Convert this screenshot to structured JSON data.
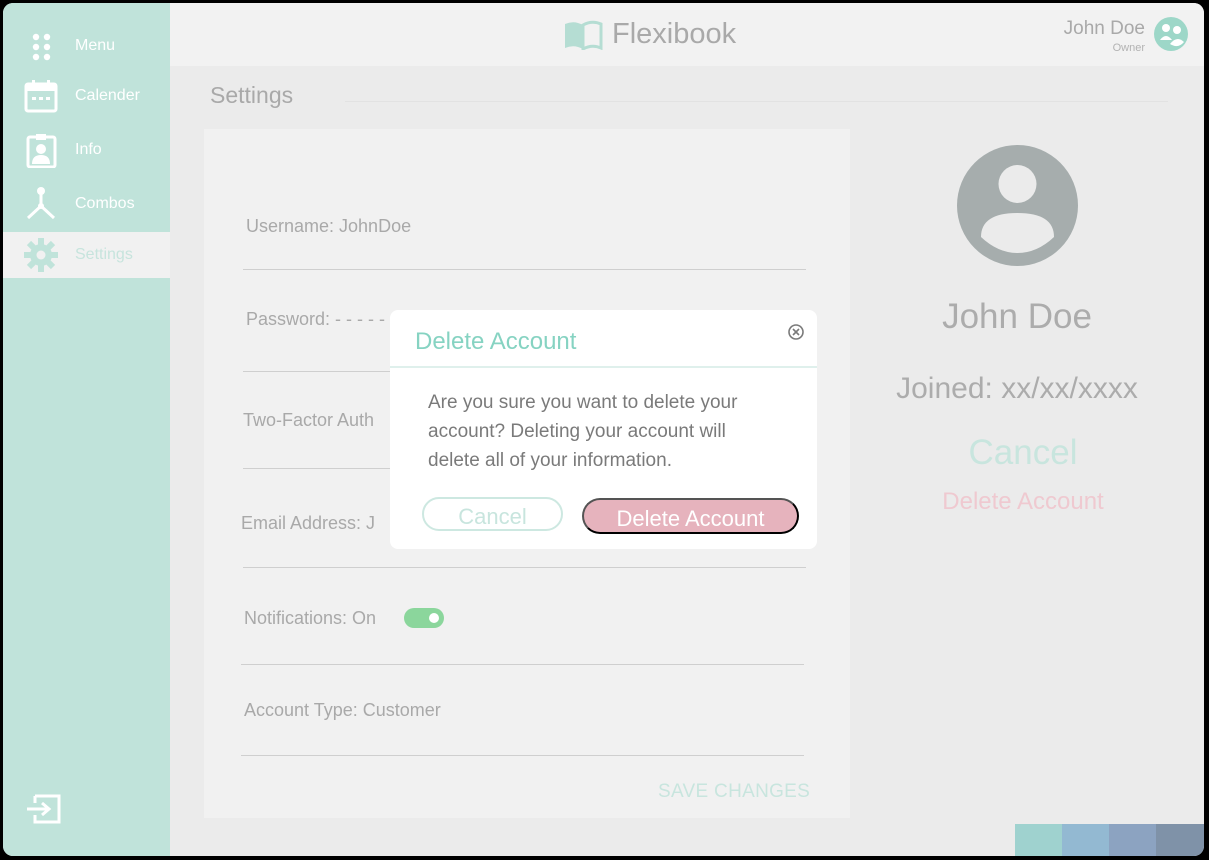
{
  "sidebar": {
    "items": [
      {
        "label": "Menu",
        "icon": "dots-grid-icon"
      },
      {
        "label": "Calender",
        "icon": "calendar-icon"
      },
      {
        "label": "Info",
        "icon": "id-badge-icon"
      },
      {
        "label": "Combos",
        "icon": "combos-icon"
      },
      {
        "label": "Settings",
        "icon": "gear-icon",
        "active": true
      }
    ],
    "logout_icon": "logout-icon"
  },
  "header": {
    "brand": "Flexibook",
    "user_name": "John Doe",
    "user_role": "Owner"
  },
  "page": {
    "title": "Settings"
  },
  "form": {
    "username": "Username: JohnDoe",
    "password": "Password: - - - - -",
    "two_factor": "Two-Factor Auth",
    "email": "Email Address: J",
    "notifications": "Notifications: On",
    "notifications_on": true,
    "account_type": "Account Type: Customer",
    "save": "SAVE CHANGES"
  },
  "profile": {
    "name": "John Doe",
    "joined": "Joined: xx/xx/xxxx",
    "cancel": "Cancel",
    "delete": "Delete Account"
  },
  "modal": {
    "title": "Delete Account",
    "body": "Are you sure you want to delete your account? Deleting your account will delete all of your information.",
    "cancel": "Cancel",
    "confirm": "Delete Account"
  },
  "colors": {
    "accent": "#c0e3da",
    "teal_text": "#86d3c2",
    "danger": "#e6b3bd",
    "swatches": [
      "#9fd2cf",
      "#93b9d2",
      "#8ca3c1",
      "#7f92a8"
    ]
  }
}
